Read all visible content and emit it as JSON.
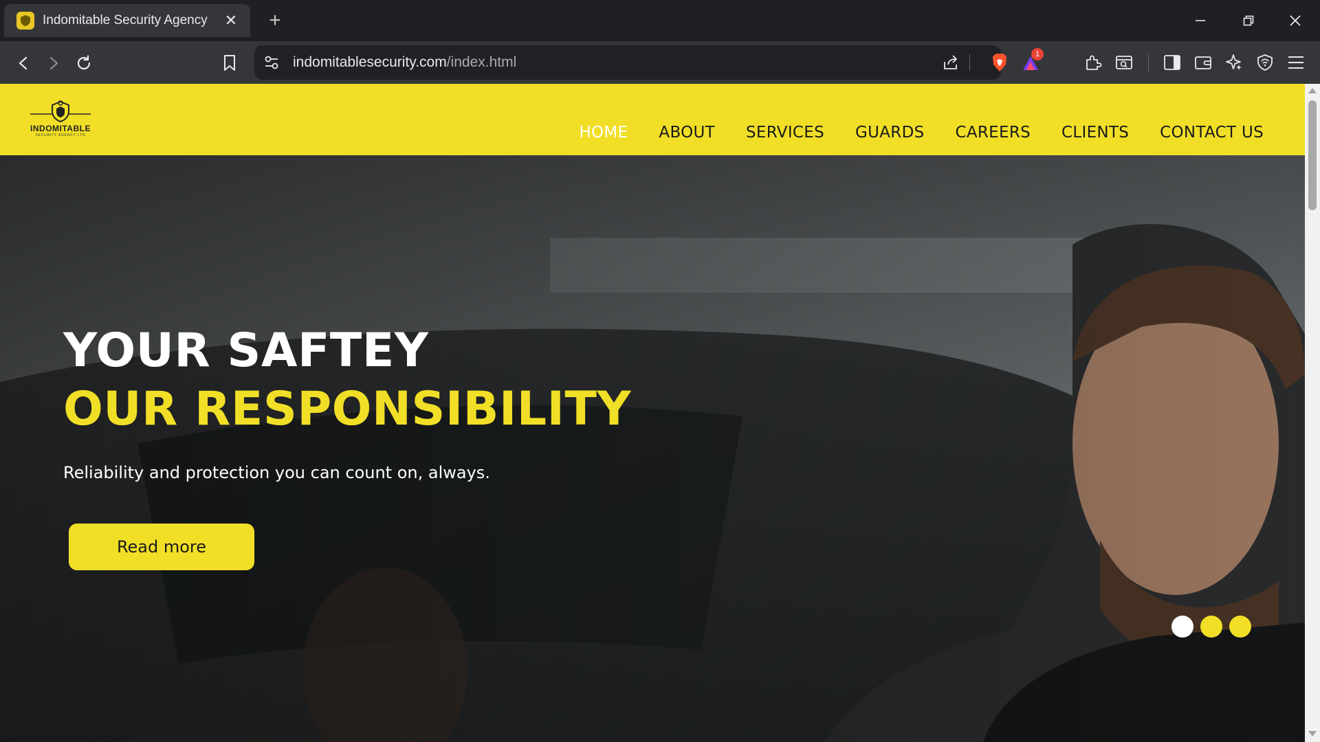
{
  "browser": {
    "tab_title": "Indomitable Security Agency",
    "tab_close": "✕",
    "new_tab": "+",
    "url_domain": "indomitablesecurity.com",
    "url_path": "/index.html",
    "rewards_badge": "1"
  },
  "site": {
    "logo_text": "INDOMITABLE",
    "logo_subtext": "SECURITY AGENCY LTD",
    "nav": {
      "home": "HOME",
      "about": "ABOUT",
      "services": "SERVICES",
      "guards": "GUARDS",
      "careers": "CAREERS",
      "clients": "CLIENTS",
      "contact": "CONTACT US"
    },
    "hero": {
      "line1": "YOUR SAFTEY",
      "line2": "OUR RESPONSIBILITY",
      "subtitle": "Reliability and protection you can count on, always.",
      "button": "Read more"
    },
    "slider_active_index": 1,
    "slider_count": 3
  },
  "colors": {
    "brand_yellow": "#f1df27",
    "nav_active": "#ffffff",
    "chrome_dark": "#35363a"
  }
}
